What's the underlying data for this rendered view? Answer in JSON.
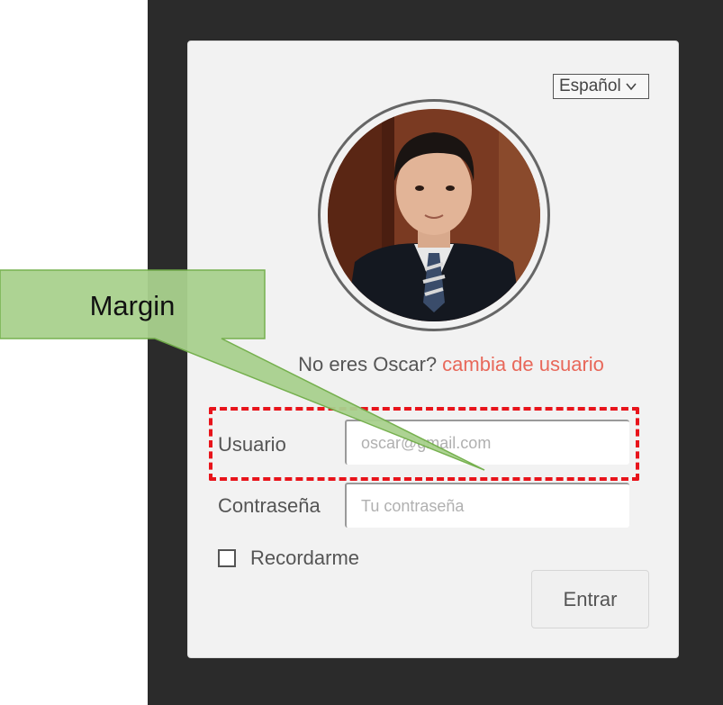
{
  "login": {
    "language": "Español",
    "prompt": "No eres Oscar?",
    "switch_link": "cambia de usuario",
    "username_label": "Usuario",
    "username_placeholder": "oscar@gmail.com",
    "password_label": "Contraseña",
    "password_placeholder": "Tu contraseña",
    "remember_label": "Recordarme",
    "submit_label": "Entrar"
  },
  "annotation": {
    "callout_text": "Margin"
  },
  "colors": {
    "dark_background": "#2b2b2b",
    "card": "#f2f2f2",
    "link": "#e8685a",
    "highlight": "#e8141b",
    "callout_fill": "#a9d18e",
    "callout_border": "#70ad47"
  }
}
